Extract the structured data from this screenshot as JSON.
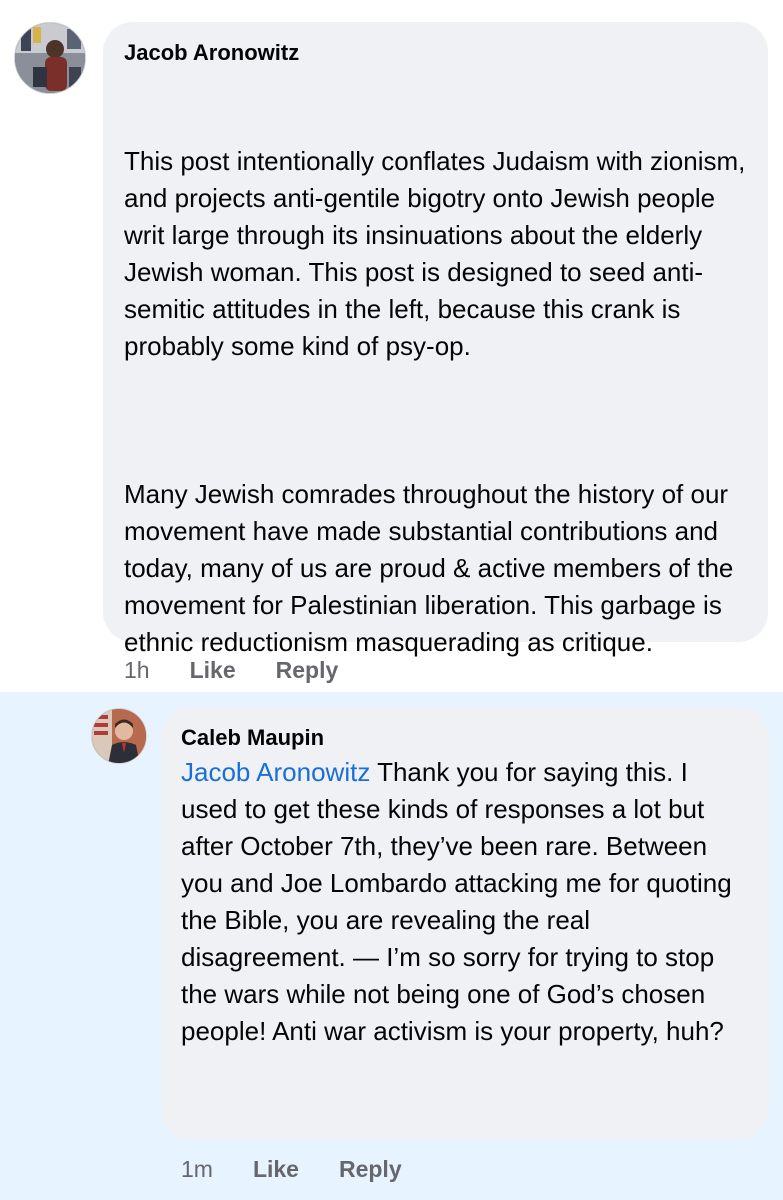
{
  "comment": {
    "author": "Jacob Aronowitz",
    "paragraphs": [
      "This post intentionally conflates Judaism with zionism, and projects anti-gentile bigotry onto Jewish people writ large through its insinuations about the elderly Jewish woman. This post is designed to seed anti-semitic attitudes in the left, because this crank is probably some kind of psy-op.",
      "Many Jewish comrades throughout the history of our movement have made substantial contributions and today, many of us are proud & active members of the movement for Palestinian liberation. This garbage is ethnic reductionism masquerading as critique."
    ],
    "time": "1h",
    "like_label": "Like",
    "reply_label": "Reply"
  },
  "reply": {
    "author": "Caleb Maupin",
    "mention": "Jacob Aronowitz",
    "text": " Thank you for saying this. I used to get these kinds of responses a lot but after October 7th, they’ve been rare. Between you and Joe Lombardo attacking me for quoting the Bible, you are revealing the real disagreement. — I’m so sorry for trying to stop the wars while not being one of God’s chosen people! Anti war activism is your property, huh?",
    "time": "1m",
    "like_label": "Like",
    "reply_label": "Reply"
  },
  "colors": {
    "bubble": "#f0f1f4",
    "highlight": "#e7f3ff",
    "mention": "#1a6ed8",
    "meta": "#65676b"
  }
}
